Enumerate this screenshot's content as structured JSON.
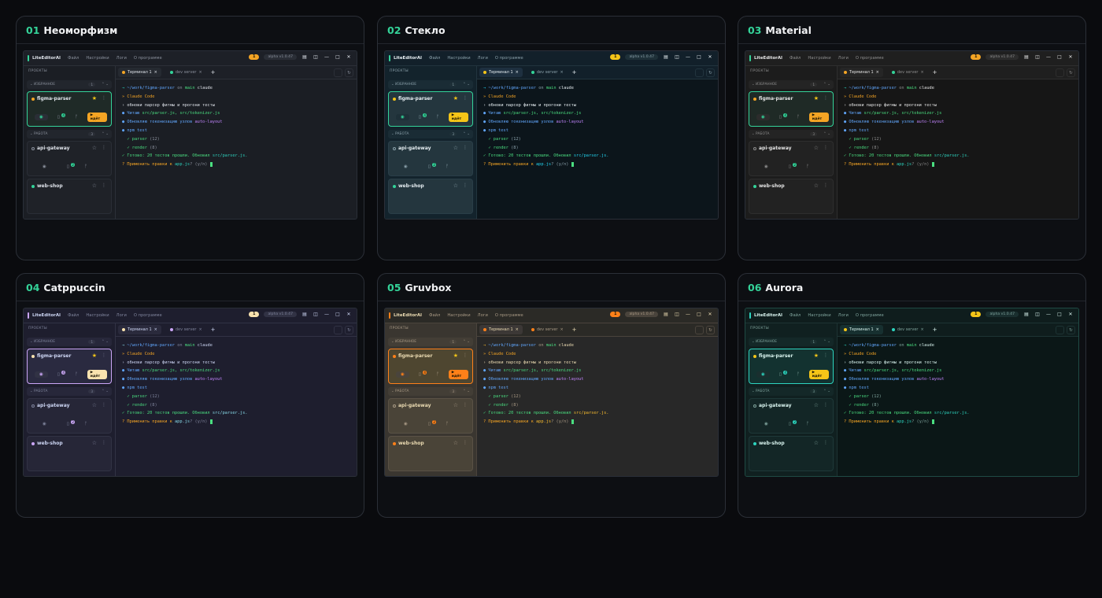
{
  "themes": [
    {
      "num": "01",
      "name": "Неоморфизм",
      "colors": {
        "bg": "#1b1e24",
        "acc": "#34d399",
        "pill": "#f5a524"
      }
    },
    {
      "num": "02",
      "name": "Стекло",
      "colors": {
        "bg": "#0f1a20",
        "acc": "#34d399",
        "pill": "#f5c518"
      }
    },
    {
      "num": "03",
      "name": "Material",
      "colors": {
        "bg": "#1a1a1a",
        "acc": "#34d399",
        "pill": "#f5a524"
      }
    },
    {
      "num": "04",
      "name": "Catppuccin",
      "colors": {
        "bg": "#1e1e2e",
        "acc": "#cba6f7",
        "pill": "#f9e2af"
      }
    },
    {
      "num": "05",
      "name": "Gruvbox",
      "colors": {
        "bg": "#282828",
        "acc": "#fe8019",
        "pill": "#fe8019"
      }
    },
    {
      "num": "06",
      "name": "Aurora",
      "colors": {
        "bg": "#0e1a1a",
        "acc": "#2dd4bf",
        "pill": "#f5c518"
      }
    }
  ],
  "app": {
    "title": "LiteEditorAI",
    "menu": [
      "Файл",
      "Настройки",
      "Логи",
      "О программе"
    ],
    "pill": "1",
    "version": "alpha v1.0.47",
    "window_controls": [
      "—",
      "□",
      "✕"
    ]
  },
  "sidebar": {
    "label": "ПРОЕКТЫ",
    "favorites": {
      "label": "ИЗБРАННОЕ",
      "count": "1"
    },
    "work": {
      "label": "РАБОТА",
      "count": "3"
    },
    "projects": [
      {
        "name": "figma-parser",
        "run": "▶ идёт",
        "badge": "4"
      },
      {
        "name": "api-gateway",
        "badge": "2"
      },
      {
        "name": "web-shop"
      }
    ]
  },
  "tabs": [
    {
      "label": "Терминал 1",
      "close": "×"
    },
    {
      "label": "dev server",
      "close": "×"
    }
  ],
  "add_tab": "+",
  "terminal": {
    "prompt_arrow": "→",
    "path": "~/work/figma-parser",
    "on": "on",
    "branch": "main",
    "cmd": "claude",
    "l2": "» Claude Code",
    "l3": "› обнови парсер фигмы и прогони тесты",
    "l4a": "● Читаю ",
    "l4b": "src/parser.js, src/tokenizer.js",
    "l5a": "● Обновляю токенизацию узлов ",
    "l5b": "auto-layout",
    "l6": "● npm test",
    "l7a": "  ✓ parser ",
    "l7b": "(12)",
    "l8a": "  ✓ render ",
    "l8b": "(8)",
    "l9a": "✓ Готово: 20 тестов прошли. Обновил ",
    "l9b": "src/parser.js.",
    "l10a": "? Применить правки к ",
    "l10b": "app.js",
    "l10c": "? (y/n)"
  }
}
